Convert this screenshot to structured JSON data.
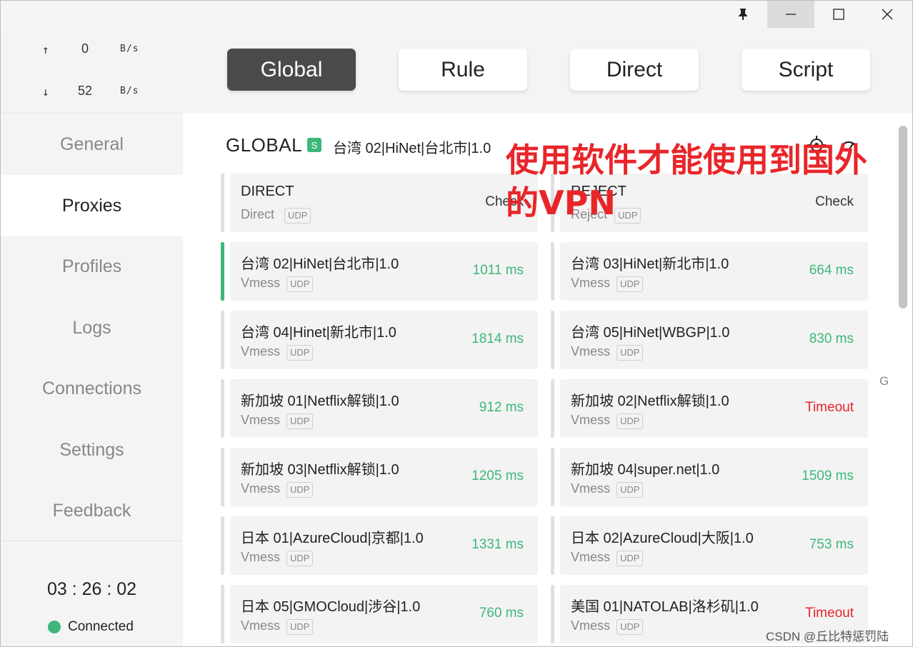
{
  "window": {
    "controls": {
      "pin": "pin-icon",
      "minimize": "minimize-icon",
      "maximize": "maximize-icon",
      "close": "close-icon"
    }
  },
  "traffic": {
    "up_arrow": "↑",
    "up_value": "0",
    "up_unit": "B/s",
    "down_arrow": "↓",
    "down_value": "52",
    "down_unit": "B/s"
  },
  "sidebar": {
    "items": [
      {
        "label": "General"
      },
      {
        "label": "Proxies"
      },
      {
        "label": "Profiles"
      },
      {
        "label": "Logs"
      },
      {
        "label": "Connections"
      },
      {
        "label": "Settings"
      },
      {
        "label": "Feedback"
      }
    ],
    "active": "Proxies",
    "timer": "03 : 26 : 02",
    "status": "Connected",
    "status_color": "#3db87a"
  },
  "modes": {
    "items": [
      {
        "label": "Global"
      },
      {
        "label": "Rule"
      },
      {
        "label": "Direct"
      },
      {
        "label": "Script"
      }
    ],
    "active": "Global"
  },
  "group": {
    "title": "GLOBAL",
    "badge": "S",
    "selected": "台湾 02|HiNet|台北市|1.0"
  },
  "annotation": "使用软件才能使用到国外的VPN",
  "side_letter": "G",
  "proxies": [
    {
      "name": "DIRECT",
      "type": "Direct",
      "udp": "UDP",
      "delay": "Check",
      "state": "check"
    },
    {
      "name": "REJECT",
      "type": "Reject",
      "udp": "UDP",
      "delay": "Check",
      "state": "check"
    },
    {
      "name": "台湾 02|HiNet|台北市|1.0",
      "type": "Vmess",
      "udp": "UDP",
      "delay": "1011 ms",
      "state": "ok",
      "selected": true
    },
    {
      "name": "台湾 03|HiNet|新北市|1.0",
      "type": "Vmess",
      "udp": "UDP",
      "delay": "664 ms",
      "state": "ok"
    },
    {
      "name": "台湾 04|Hinet|新北市|1.0",
      "type": "Vmess",
      "udp": "UDP",
      "delay": "1814 ms",
      "state": "ok"
    },
    {
      "name": "台湾 05|HiNet|WBGP|1.0",
      "type": "Vmess",
      "udp": "UDP",
      "delay": "830 ms",
      "state": "ok"
    },
    {
      "name": "新加坡 01|Netflix解锁|1.0",
      "type": "Vmess",
      "udp": "UDP",
      "delay": "912 ms",
      "state": "ok"
    },
    {
      "name": "新加坡 02|Netflix解锁|1.0",
      "type": "Vmess",
      "udp": "UDP",
      "delay": "Timeout",
      "state": "timeout"
    },
    {
      "name": "新加坡 03|Netflix解锁|1.0",
      "type": "Vmess",
      "udp": "UDP",
      "delay": "1205 ms",
      "state": "ok"
    },
    {
      "name": "新加坡 04|super.net|1.0",
      "type": "Vmess",
      "udp": "UDP",
      "delay": "1509 ms",
      "state": "ok"
    },
    {
      "name": "日本 01|AzureCloud|京都|1.0",
      "type": "Vmess",
      "udp": "UDP",
      "delay": "1331 ms",
      "state": "ok"
    },
    {
      "name": "日本 02|AzureCloud|大阪|1.0",
      "type": "Vmess",
      "udp": "UDP",
      "delay": "753 ms",
      "state": "ok"
    },
    {
      "name": "日本 05|GMOCloud|涉谷|1.0",
      "type": "Vmess",
      "udp": "UDP",
      "delay": "760 ms",
      "state": "ok"
    },
    {
      "name": "美国 01|NATOLAB|洛杉矶|1.0",
      "type": "Vmess",
      "udp": "UDP",
      "delay": "Timeout",
      "state": "timeout"
    }
  ],
  "colors": {
    "ok": "#3db87a",
    "timeout": "#e8262a",
    "active_mode_bg": "#4a4a4a"
  },
  "watermark": "CSDN @丘比特惩罚陆"
}
